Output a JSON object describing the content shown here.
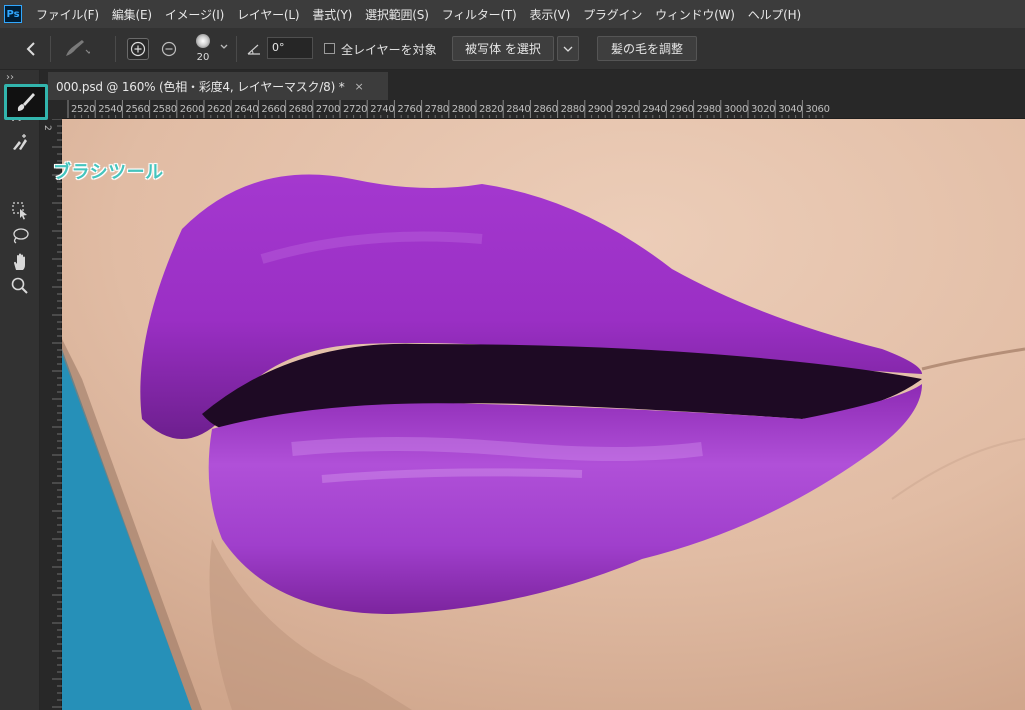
{
  "menu": {
    "items": [
      "ファイル(F)",
      "編集(E)",
      "イメージ(I)",
      "レイヤー(L)",
      "書式(Y)",
      "選択範囲(S)",
      "フィルター(T)",
      "表示(V)",
      "プラグイン",
      "ウィンドウ(W)",
      "ヘルプ(H)"
    ],
    "logo": "Ps"
  },
  "options": {
    "brush_size": "20",
    "angle_value": "0°",
    "all_layers_label": "全レイヤーを対象",
    "select_subject_label": "被写体 を選択",
    "refine_hair_label": "髪の毛を調整"
  },
  "document": {
    "tab_title": "000.psd @ 160% (色相・彩度4, レイヤーマスク/8) *",
    "close_glyph": "×"
  },
  "ruler": {
    "h_ticks": [
      "2520",
      "2540",
      "2560",
      "2580",
      "2600",
      "2620",
      "2640",
      "2660",
      "2680",
      "2700",
      "2720",
      "2740",
      "2760",
      "2780",
      "2800",
      "2820",
      "2840",
      "2860",
      "2880",
      "2900",
      "2920",
      "2940",
      "2960",
      "2980",
      "3000",
      "3020",
      "3040",
      "3060"
    ],
    "v_label": "2"
  },
  "toolbar": {
    "tools": [
      "quick-selection-icon",
      "quick-selection-add-icon",
      "brush-icon",
      "object-selection-icon",
      "lasso-icon",
      "hand-icon",
      "zoom-icon"
    ],
    "active_tool": "brush-icon"
  },
  "annotation": {
    "callout_text": "ブラシツール",
    "callout_color": "#45c4bd"
  },
  "colors": {
    "lip": "#9a2fc4",
    "skin": "#e1bca4",
    "background": "#2690b8",
    "ui_dark": "#323232"
  }
}
